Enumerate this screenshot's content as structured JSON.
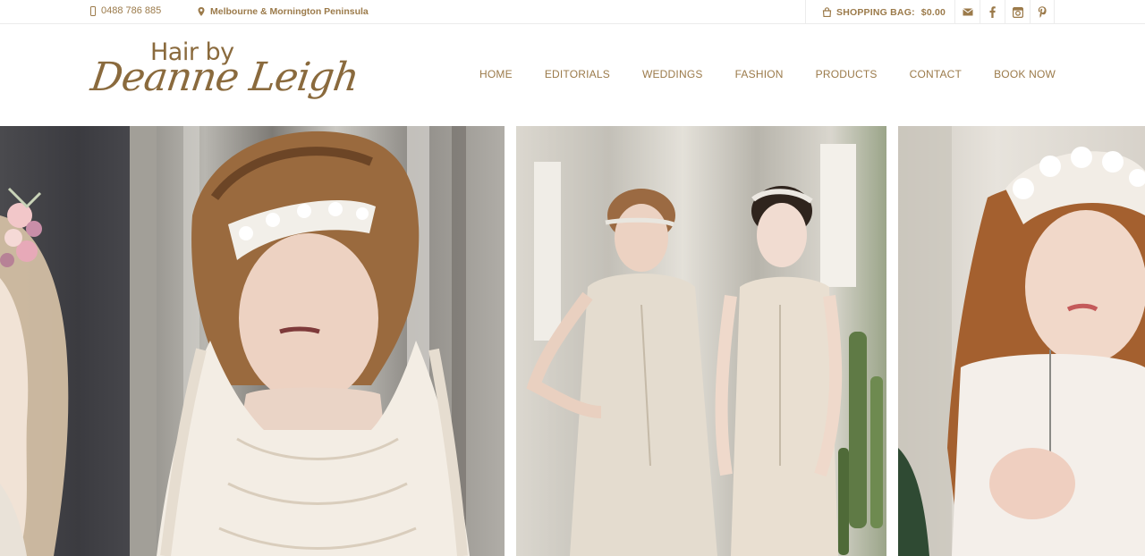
{
  "topbar": {
    "phone": "0488 786 885",
    "location": "Melbourne & Mornington Peninsula",
    "bag_label": "SHOPPING BAG:",
    "bag_total": "$0.00",
    "socials": [
      "email-icon",
      "facebook-icon",
      "instagram-icon",
      "pinterest-icon"
    ]
  },
  "logo": {
    "line1": "Hair by",
    "line2": "Deanne Leigh"
  },
  "nav": {
    "items": [
      "HOME",
      "EDITORIALS",
      "WEDDINGS",
      "FASHION",
      "PRODUCTS",
      "CONTACT",
      "BOOK NOW"
    ]
  },
  "theme": {
    "accent": "#9b7a4a",
    "border": "#ececec"
  },
  "gallery": {
    "photos": [
      "bride-floral-crown-photo",
      "bride-beaded-headband-photo",
      "two-brides-vintage-photo",
      "bride-lace-headpiece-photo"
    ]
  }
}
